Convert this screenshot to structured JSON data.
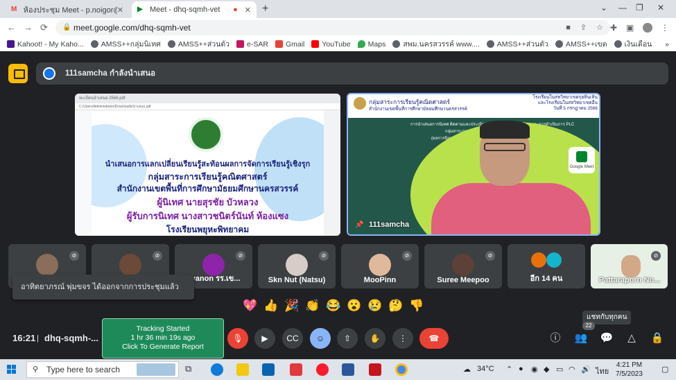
{
  "tabs": [
    {
      "title": "ห้องประชุม Meet - p.noigor@gma",
      "favicon": "gmail-icon"
    },
    {
      "title": "Meet - dhq-sqmh-vet",
      "favicon": "meet-icon"
    }
  ],
  "url": "meet.google.com/dhq-sqmh-vet",
  "bookmarks": [
    "Kahoot! - My Kaho...",
    "AMSS++กลุ่มนิเทศ",
    "AMSS++ส่วนตัว",
    "e-SAR",
    "Gmail",
    "YouTube",
    "Maps",
    "สพม.นครสวรรค์ www....",
    "AMSS++ส่วนตัว",
    "AMSS++เขต",
    "เงินเดือน"
  ],
  "presenter_bar": {
    "text": "111samcha กำลังนำเสนอ"
  },
  "slide": {
    "browser_tab": "ทะเบียนนำเสนอ 2566.pdf",
    "addr": "C:/Users/Administrator/Downloads/นำเสนอ.pdf",
    "line1": "นำเสนอการแลกเปลี่ยนเรียนรู้สะท้อนผลการจัดการเรียนรู้เชิงรุก",
    "line2": "กลุ่มสาระการเรียนรู้คณิตศาสตร์",
    "line3": "สำนักงานเขตพื้นที่การศึกษามัธยมศึกษานครสวรรค์",
    "line4": "ผู้นิเทศ นายสุรชัย บัวหลวง",
    "line5": "ผู้รับการนิเทศ นางสาวชนิตร์นันท์ ห้องแซง",
    "line6": "โรงเรียนพยุหะพิทยาคม"
  },
  "video_tile": {
    "header1": "กลุ่มสาระการเรียนรู้คณิตศาสตร์",
    "header2": "สำนักงานเขตพื้นที่การศึกษามัธยมศึกษานครสวรรค์",
    "header_right1": "โรงเรียนในสหวิทยาเขตกุยหินเหิน",
    "header_right2": "และโรงเรียนในสหวิทยาเขตอื่น",
    "header_right3": "วันที่ 5 กรกฎาคม 2566",
    "board1": "การนำเสนอการนิเทศ ติดตามและประเมินผลการจัดการเรียนรู้เชิงรุกและการดำเนินการ PLC",
    "board2": "กลุ่มสาระการเรียนรู้คณิตศาสตร์ ภาคเรียนที่ 1 ปีการศึกษา 2566",
    "board3": "(ผลการนิเทศตามแบบนิเทศจากการนิเทศครูผู้รับการนิเทศ)",
    "badge": "Google Meet",
    "name": "111samcha"
  },
  "participants": [
    {
      "name": "",
      "muted": true
    },
    {
      "name": "",
      "muted": true
    },
    {
      "name": "ayanon รร.เข...",
      "muted": true
    },
    {
      "name": "Skn Nut (Natsu)",
      "muted": true
    },
    {
      "name": "MooPinn",
      "muted": true
    },
    {
      "name": "Suree Meepoo",
      "muted": true
    },
    {
      "name": "อีก 14 คน",
      "muted": false
    },
    {
      "name": "Pattaraporn No...",
      "muted": true
    }
  ],
  "toast": "อาทิตยาภรณ์ พุ่มขจร ได้ออกจากการประชุมแล้ว",
  "reactions": [
    "💖",
    "👍",
    "🎉",
    "👏",
    "😂",
    "😮",
    "😢",
    "🤔",
    "👎"
  ],
  "tooltip": "แชทกับทุกคน",
  "time": "16:21",
  "meeting_code": "dhq-sqmh-...",
  "tracking": {
    "line1": "Tracking Started",
    "line2": "1 hr 36 min 19s ago",
    "line3": "Click To Generate Report"
  },
  "people_count": "22",
  "taskbar": {
    "search_placeholder": "Type here to search",
    "weather": "34°C",
    "lang": "ไทย",
    "time": "4:21 PM",
    "date": "7/5/2023"
  }
}
